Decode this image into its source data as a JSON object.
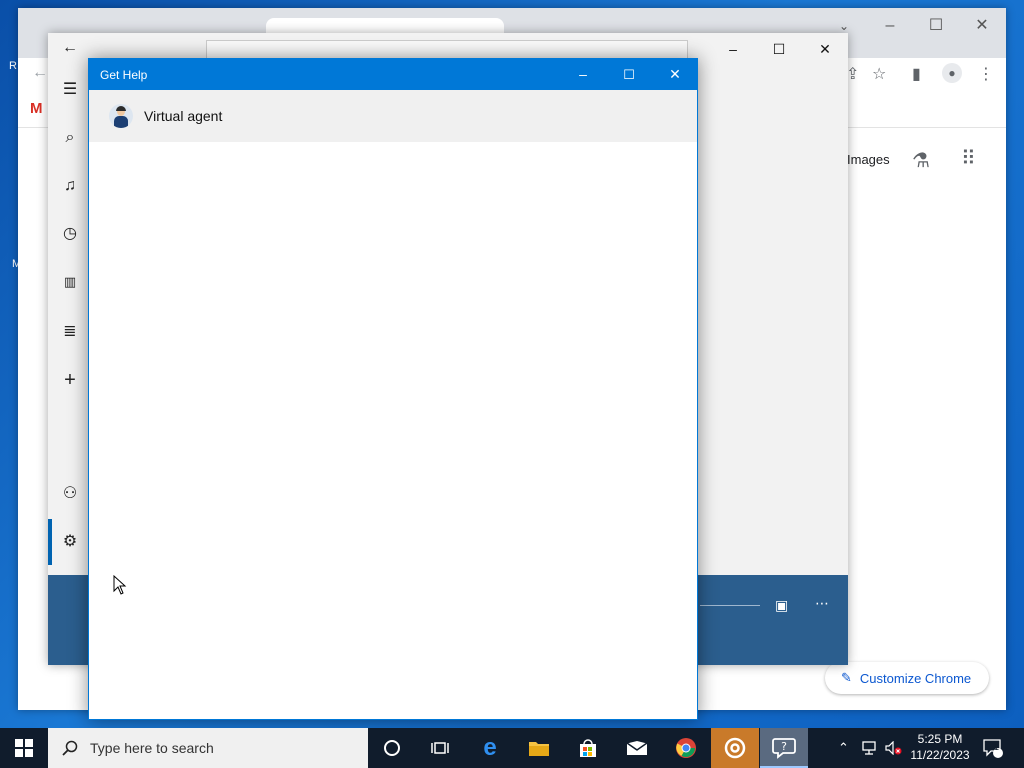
{
  "desktop": {
    "edge_letters": [
      "R",
      "M"
    ]
  },
  "chrome": {
    "images_link": "Images",
    "customize_label": "Customize Chrome",
    "gmail_letter": "M"
  },
  "gethelp": {
    "title": "Get Help",
    "items": [
      {
        "label": "Virtual agent"
      }
    ]
  },
  "taskbar": {
    "search_placeholder": "Type here to search",
    "time": "5:25 PM",
    "date": "11/22/2023",
    "notification_count": "1"
  },
  "colors": {
    "gethelp_accent": "#0078d7",
    "groove_bar": "#2b5e8e",
    "taskbar": "#101c2c",
    "chrome_link": "#0b57d0"
  }
}
